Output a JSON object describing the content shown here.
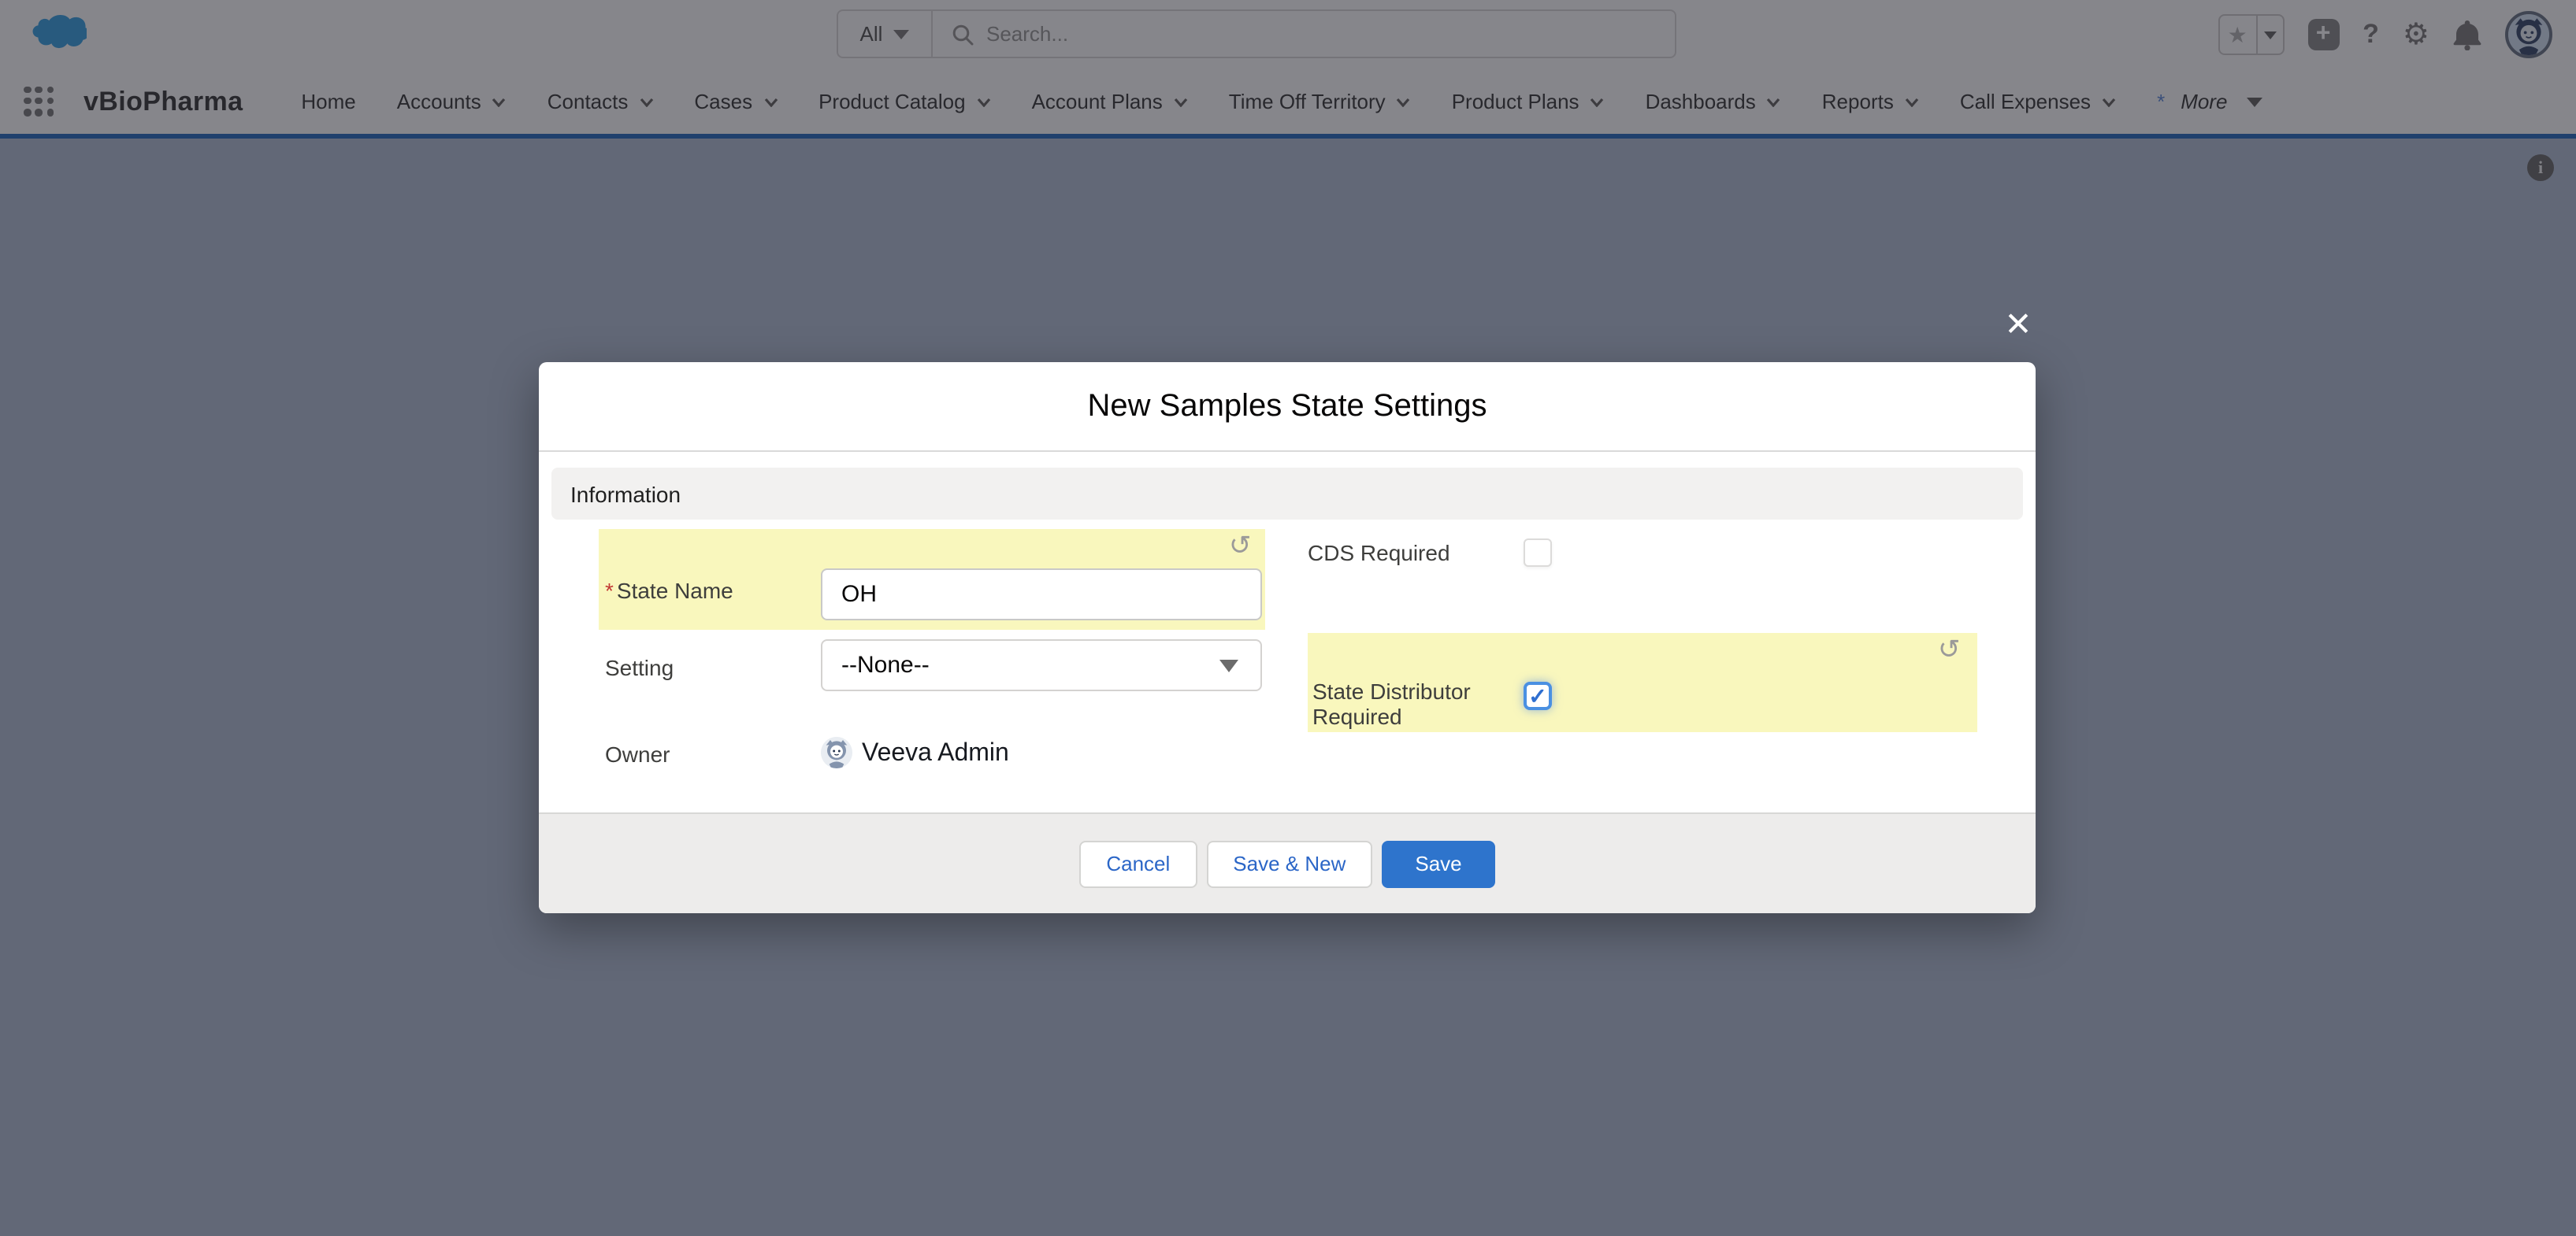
{
  "header": {
    "search": {
      "scope": "All",
      "placeholder": "Search..."
    },
    "icons": {
      "logo": "salesforce-cloud",
      "search": "magnifier",
      "favorites": "star",
      "favorites_menu": "chevron-down",
      "global_actions": "plus",
      "help": "question-mark",
      "setup": "gear",
      "notifications": "bell",
      "user": "astro-avatar",
      "help_glyph": "?",
      "gear_glyph": "⚙",
      "plus_glyph": "+",
      "star_glyph": "★"
    }
  },
  "nav": {
    "app_name": "vBioPharma",
    "items": [
      {
        "label": "Home"
      },
      {
        "label": "Accounts"
      },
      {
        "label": "Contacts"
      },
      {
        "label": "Cases"
      },
      {
        "label": "Product Catalog"
      },
      {
        "label": "Account Plans"
      },
      {
        "label": "Time Off Territory"
      },
      {
        "label": "Product Plans"
      },
      {
        "label": "Dashboards"
      },
      {
        "label": "Reports"
      },
      {
        "label": "Call Expenses"
      }
    ],
    "more": {
      "prefix": "*",
      "label": "More"
    },
    "info_glyph": "i"
  },
  "modal": {
    "title": "New Samples State Settings",
    "close_glyph": "✕",
    "section": "Information",
    "required_mark": "*",
    "undo_glyph": "↺",
    "fields": {
      "state_name": {
        "label": "State Name",
        "required": true,
        "value": "OH"
      },
      "setting": {
        "label": "Setting",
        "value": "--None--"
      },
      "owner": {
        "label": "Owner",
        "value": "Veeva Admin"
      },
      "cds_required": {
        "label": "CDS Required",
        "checked": false
      },
      "state_distributor_required": {
        "label": "State Distributor Required",
        "checked": true,
        "check_glyph": "✓"
      }
    },
    "buttons": {
      "cancel": "Cancel",
      "save_new": "Save & New",
      "save": "Save"
    }
  },
  "colors": {
    "brand_button": "#2e74cc",
    "highlight_yellow": "#f9f7bd",
    "nav_underline": "#0e5ab8",
    "required_red": "#c23934",
    "backdrop": "rgba(47,47,55,0.58)"
  }
}
